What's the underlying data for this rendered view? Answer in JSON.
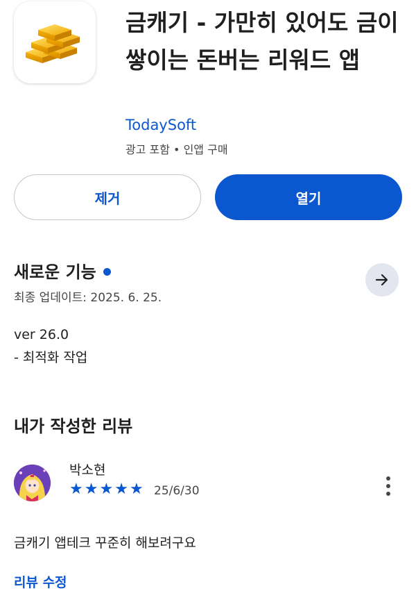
{
  "app": {
    "icon": "gold-bars-icon",
    "title": "금캐기 - 가만히 있어도 금이 쌓이는 돈버는 리워드 앱",
    "developer": "TodaySoft",
    "meta": "광고 포함 • 인앱 구매"
  },
  "actions": {
    "remove_label": "제거",
    "open_label": "열기"
  },
  "whats_new": {
    "title": "새로운 기능",
    "updated": "최종 업데이트: 2025. 6. 25.",
    "notes": [
      "ver 26.0",
      "- 최적화 작업"
    ],
    "arrow_icon": "arrow-right-icon"
  },
  "my_review": {
    "section_title": "내가 작성한 리뷰",
    "reviewer": "박소현",
    "rating": 5,
    "date": "25/6/30",
    "text": "금캐기 앱테크 꾸준히 해보려구요",
    "edit_label": "리뷰 수정"
  },
  "colors": {
    "accent": "#0b57d0",
    "text_primary": "#1f1f1f",
    "text_secondary": "#444746"
  }
}
